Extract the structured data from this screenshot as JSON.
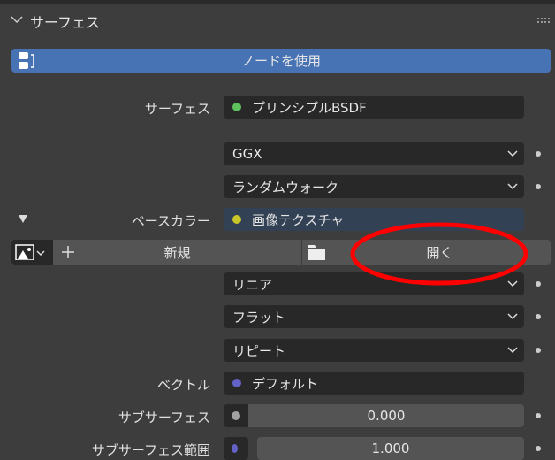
{
  "panel": {
    "title": "サーフェス"
  },
  "use_nodes_button": "ノードを使用",
  "surface": {
    "label": "サーフェス",
    "value": "プリンシプルBSDF",
    "color": "#5ec15e"
  },
  "distribution": "GGX",
  "subsurface_method": "ランダムウォーク",
  "base_color": {
    "label": "ベースカラー",
    "value": "画像テクスチャ",
    "color": "#c8c629"
  },
  "texture": {
    "new_label": "新規",
    "open_label": "開く"
  },
  "interpolation": "リニア",
  "projection": "フラット",
  "extension": "リピート",
  "vector": {
    "label": "ベクトル",
    "value": "デフォルト",
    "color": "#6363c7"
  },
  "subsurface": {
    "label": "サブサーフェス",
    "value": "0.000",
    "color": "#a1a1a1"
  },
  "subsurface_radius": {
    "label": "サブサーフェス範囲",
    "value": "1.000",
    "color": "#6363c7"
  },
  "annotation_color": "#ff0000"
}
